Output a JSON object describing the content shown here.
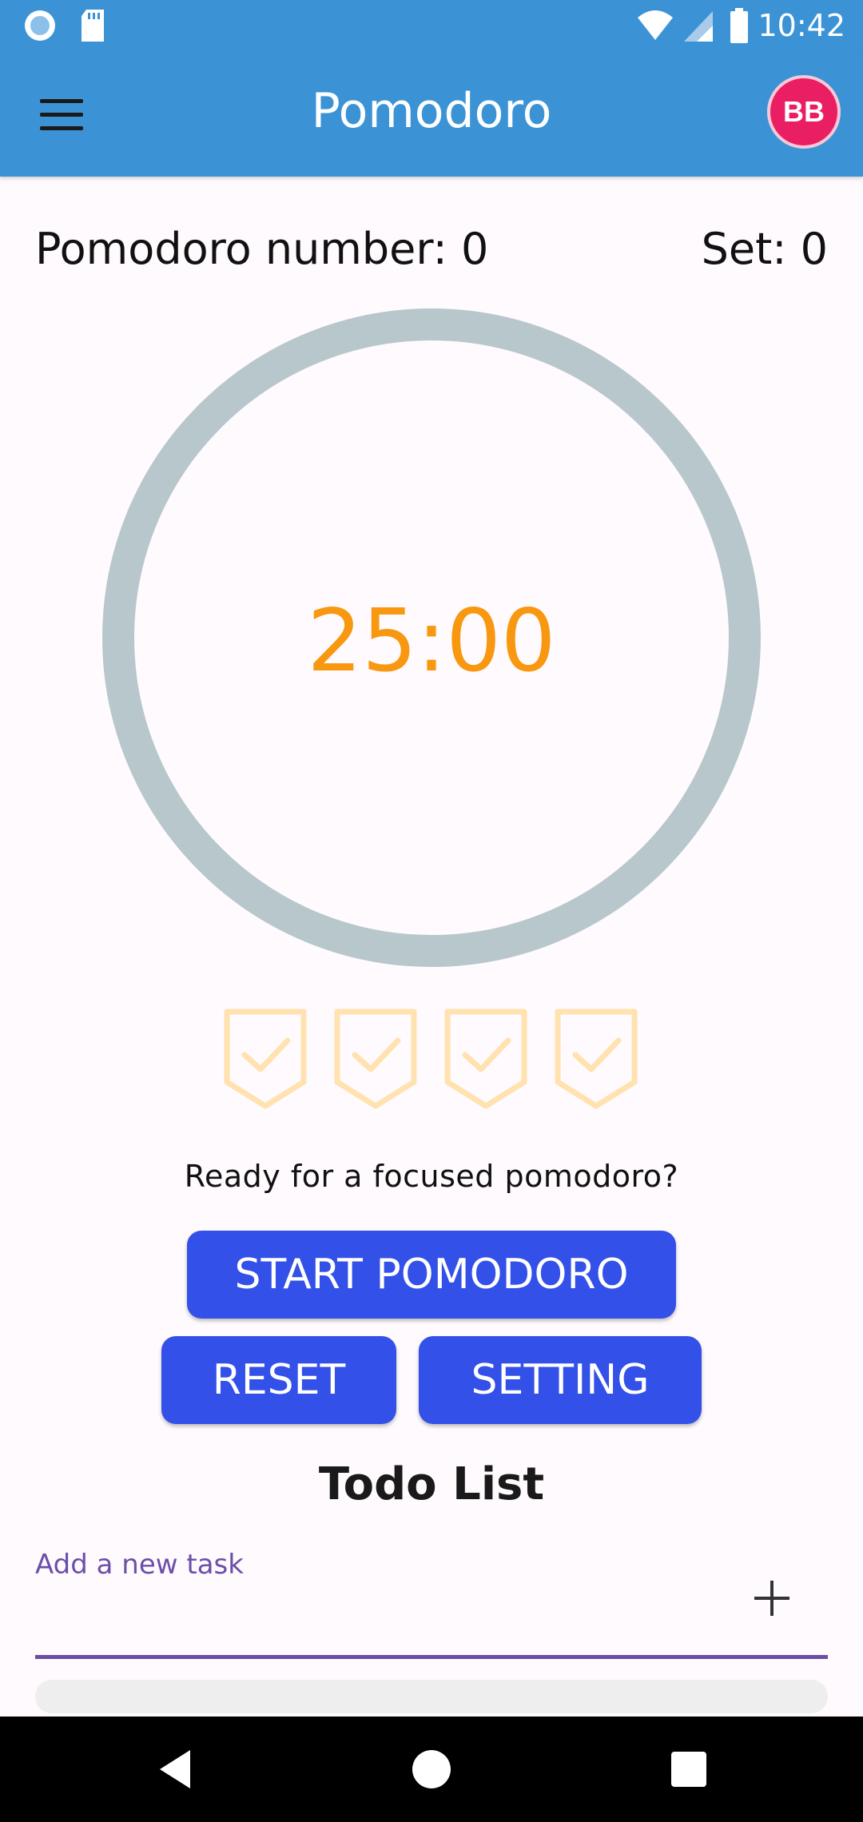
{
  "status_bar": {
    "time": "10:42",
    "icons": [
      "circle-notification-icon",
      "sd-card-icon",
      "wifi-icon",
      "signal-icon",
      "battery-icon"
    ]
  },
  "app_bar": {
    "menu_icon": "hamburger-menu-icon",
    "title": "Pomodoro",
    "avatar_initials": "BB",
    "color": "#3B93D6",
    "avatar_color": "#E91E63"
  },
  "counters": {
    "pomodoro_label": "Pomodoro number: 0",
    "set_label": "Set: 0"
  },
  "timer": {
    "display": "25:00",
    "progress": 0,
    "ring_color": "#B7C7CB",
    "text_color": "#F89810"
  },
  "badges": {
    "icon": "check-shield-icon",
    "count": 4,
    "completed": 0,
    "color": "#FFE2B0"
  },
  "prompt": "Ready for a focused pomodoro?",
  "buttons": {
    "start": "START POMODORO",
    "reset": "RESET",
    "setting": "SETTING",
    "color": "#3350E8"
  },
  "todo": {
    "title": "Todo List",
    "input_label": "Add a new task",
    "input_value": "",
    "add_icon": "plus-icon"
  },
  "nav_bar": {
    "icons": [
      "back-icon",
      "home-icon",
      "recents-icon"
    ]
  }
}
